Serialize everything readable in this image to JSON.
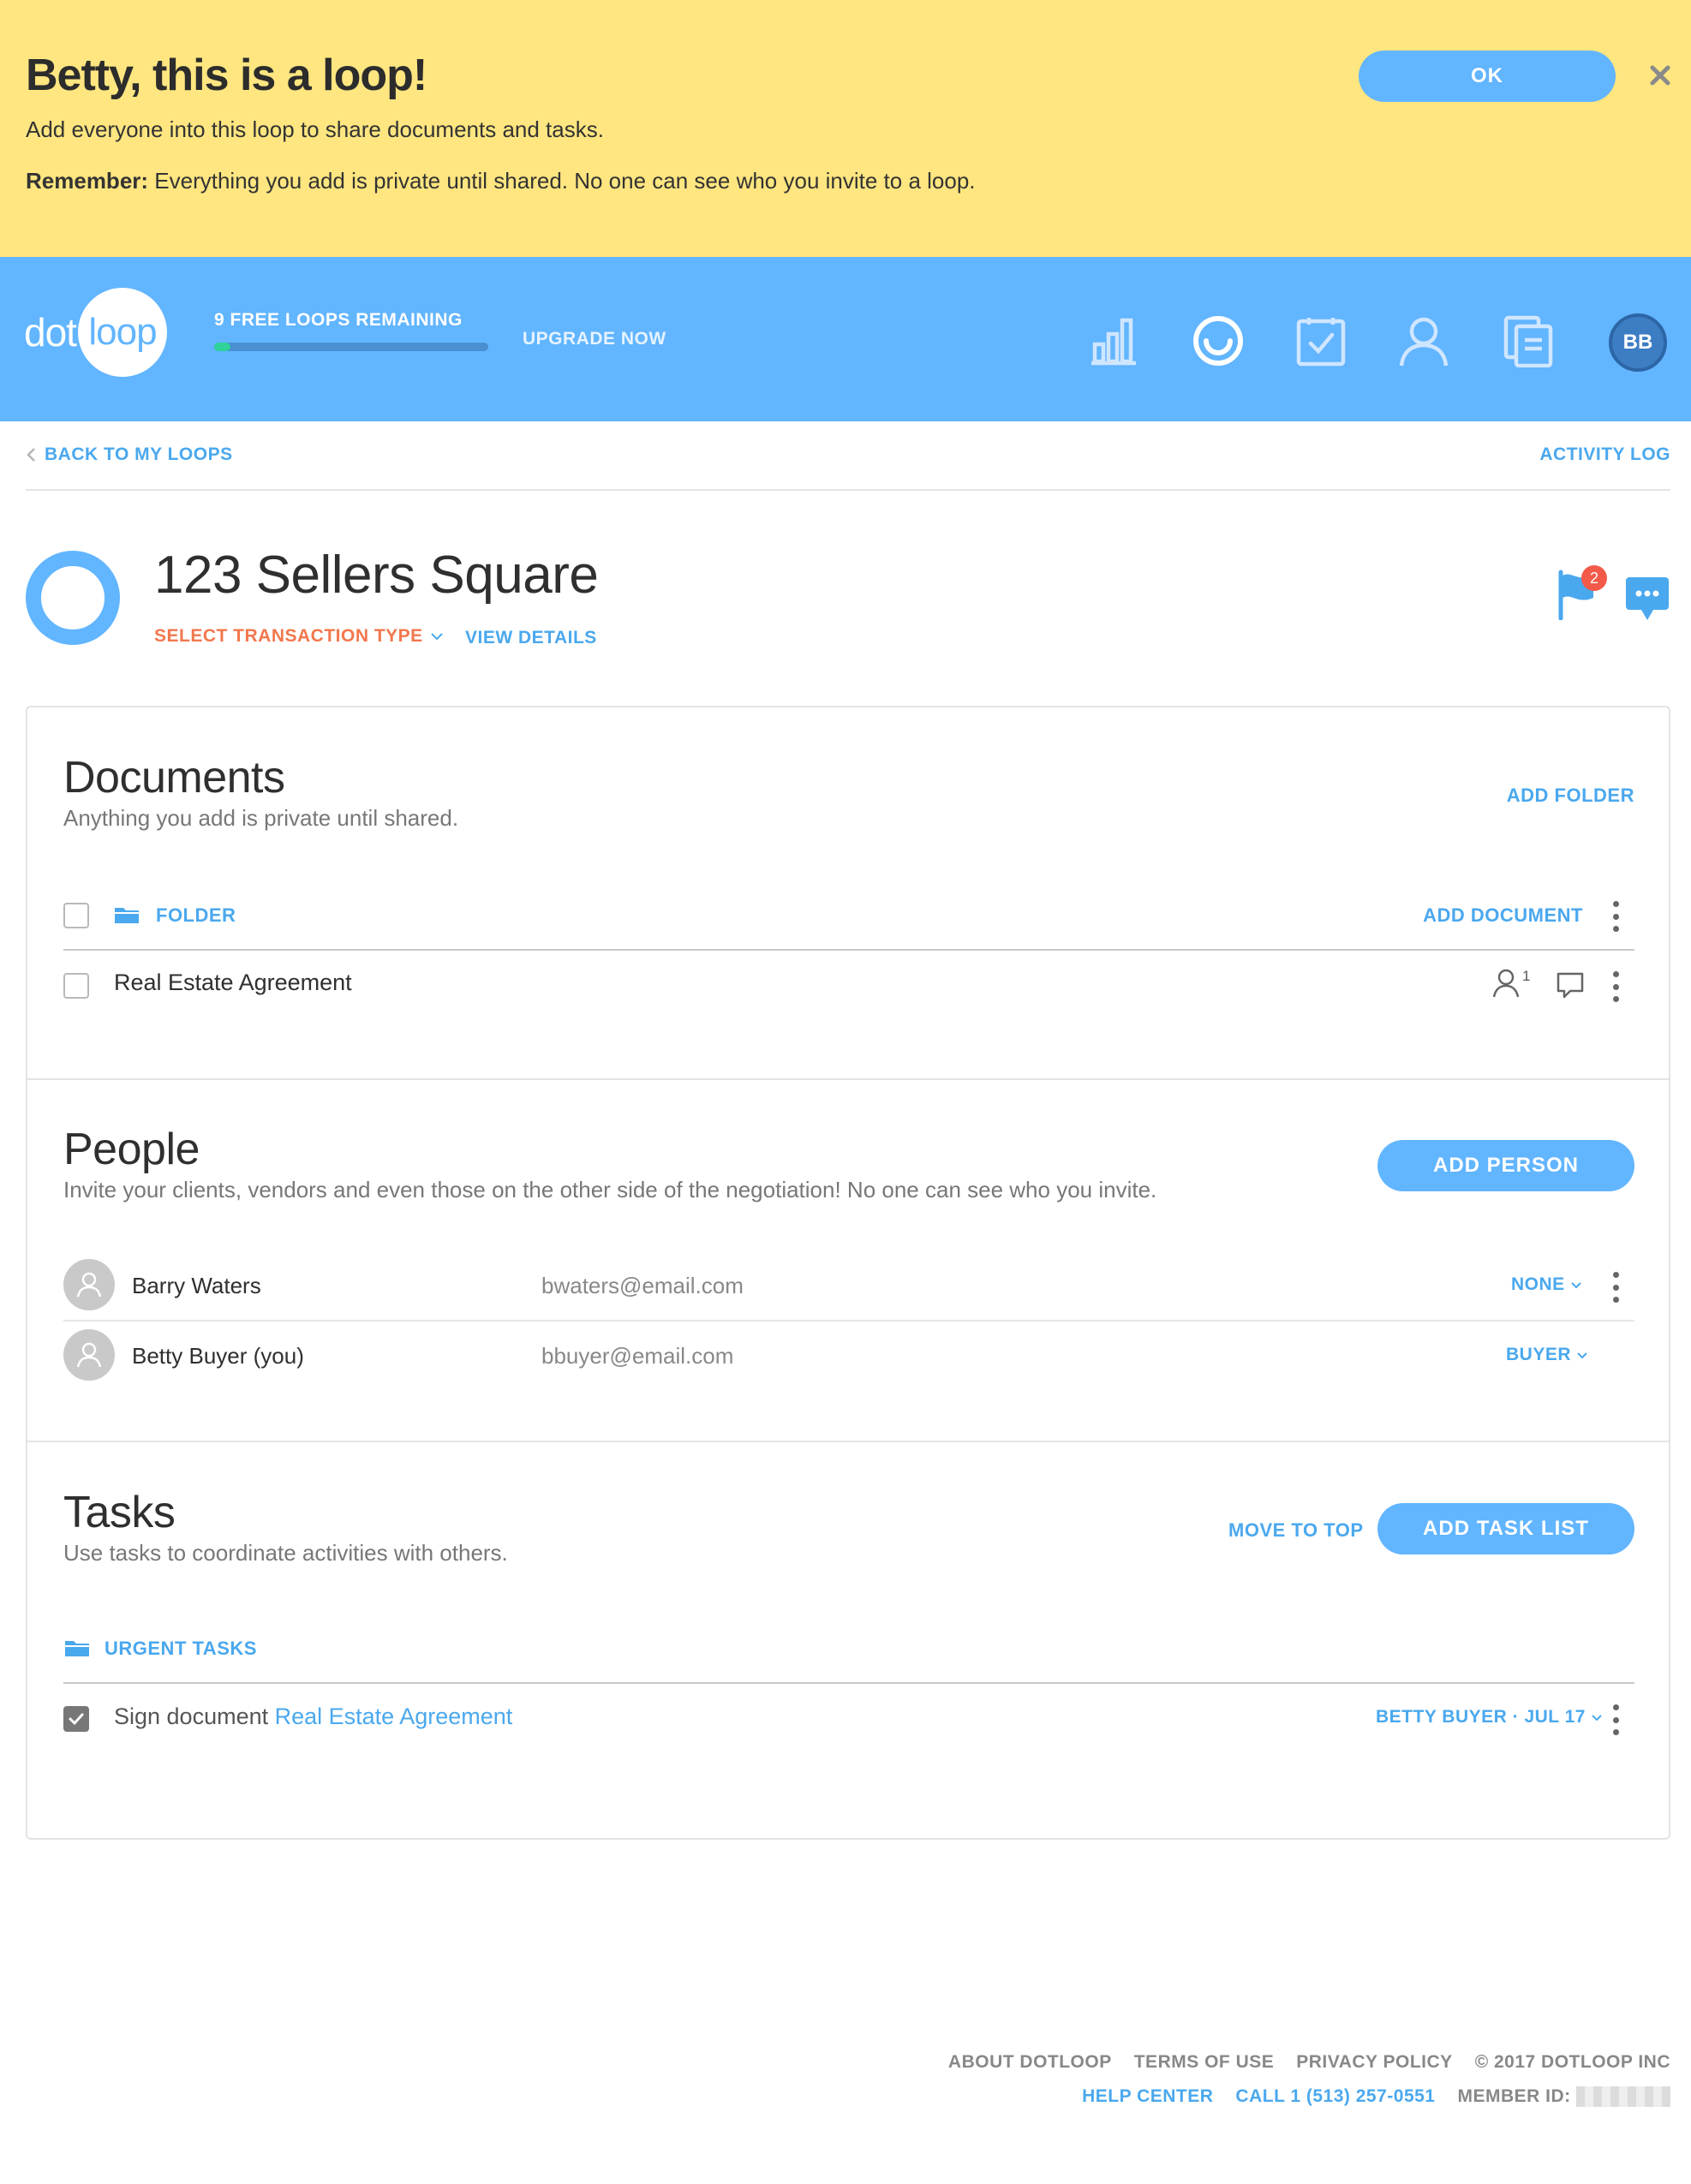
{
  "notice": {
    "title": "Betty, this is a loop!",
    "text": "Add everyone into this loop to share documents and tasks.",
    "remember_label": "Remember:",
    "remember_text": " Everything you add is private until shared. No one can see who you invite to a loop.",
    "ok_label": "OK",
    "close_icon": "close-icon"
  },
  "header": {
    "logo_dot": "dot",
    "logo_loop": "loop",
    "loops_remaining": "9 FREE LOOPS REMAINING",
    "loops_progress_fraction": 0.06,
    "upgrade_label": "UPGRADE NOW",
    "nav_icons": [
      "bar-chart-icon",
      "loop-icon",
      "tasks-check-icon",
      "contacts-person-icon",
      "documents-icon"
    ],
    "avatar_initials": "BB"
  },
  "subnav": {
    "back_label": "BACK TO MY LOOPS",
    "activity_label": "ACTIVITY LOG"
  },
  "loop": {
    "title": "123 Sellers Square",
    "transaction_type_label": "SELECT TRANSACTION TYPE",
    "view_details_label": "VIEW DETAILS",
    "flag_count": "2"
  },
  "documents": {
    "title": "Documents",
    "subtitle": "Anything you add is private until shared.",
    "add_folder_label": "ADD FOLDER",
    "folder_label": "FOLDER",
    "add_document_label": "ADD DOCUMENT",
    "items": [
      {
        "name": "Real Estate Agreement",
        "shared_count": "1"
      }
    ]
  },
  "people": {
    "title": "People",
    "subtitle": "Invite your clients, vendors and even those on the other side of the negotiation! No one can see who you invite.",
    "add_person_label": "ADD PERSON",
    "items": [
      {
        "name": "Barry Waters",
        "email": "bwaters@email.com",
        "role": "NONE"
      },
      {
        "name": "Betty Buyer (you)",
        "email": "bbuyer@email.com",
        "role": "BUYER"
      }
    ]
  },
  "tasks": {
    "title": "Tasks",
    "subtitle": "Use tasks to coordinate activities with others.",
    "move_to_top_label": "MOVE TO TOP",
    "add_task_list_label": "ADD TASK LIST",
    "list_label": "URGENT TASKS",
    "items": [
      {
        "prefix": "Sign document ",
        "link": "Real Estate Agreement",
        "assignee": "BETTY BUYER · JUL 17",
        "checked": true
      }
    ]
  },
  "footer": {
    "about": "ABOUT DOTLOOP",
    "terms": "TERMS OF USE",
    "privacy": "PRIVACY POLICY",
    "copyright": "© 2017 DOTLOOP INC",
    "help": "HELP CENTER",
    "call": "CALL 1 (513) 257-0551",
    "member_label": "MEMBER ID:"
  },
  "colors": {
    "banner": "#ffe680",
    "brand_blue": "#62b5ff",
    "link_blue": "#4aa8ee",
    "accent_orange": "#f2774d",
    "progress_green": "#2fd39a",
    "badge_red": "#f35a4a"
  }
}
